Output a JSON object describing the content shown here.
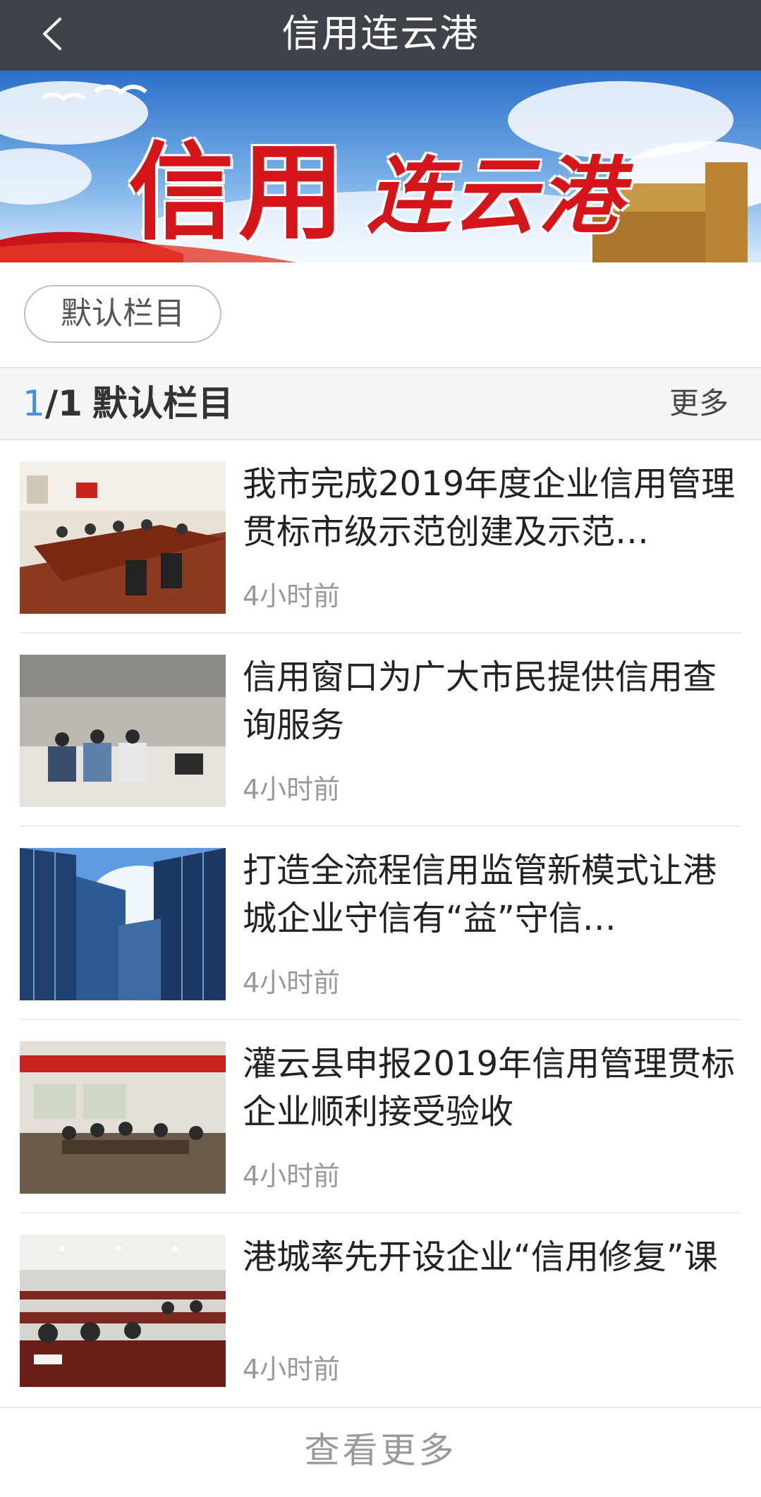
{
  "navbar": {
    "title": "信用连云港",
    "back_icon": "chevron-left-icon"
  },
  "banner": {
    "text_part1": "信用",
    "text_part2": "连云港"
  },
  "category": {
    "active_label": "默认栏目"
  },
  "section": {
    "current_page": "1",
    "total_pages": "/1",
    "title": "默认栏目",
    "more_label": "更多"
  },
  "news": [
    {
      "title": "我市完成2019年度企业信用管理贯标市级示范创建及示范…",
      "time": "4小时前"
    },
    {
      "title": "信用窗口为广大市民提供信用查询服务",
      "time": "4小时前"
    },
    {
      "title": "打造全流程信用监管新模式让港城企业守信有“益”守信…",
      "time": "4小时前"
    },
    {
      "title": "灌云县申报2019年信用管理贯标企业顺利接受验收",
      "time": "4小时前"
    },
    {
      "title": "港城率先开设企业“信用修复”课",
      "time": "4小时前"
    }
  ],
  "footer": {
    "load_more_label": "查看更多"
  },
  "colors": {
    "navbar_bg": "#3e434a",
    "accent_blue": "#4a8cd8",
    "banner_red": "#d4161b"
  }
}
